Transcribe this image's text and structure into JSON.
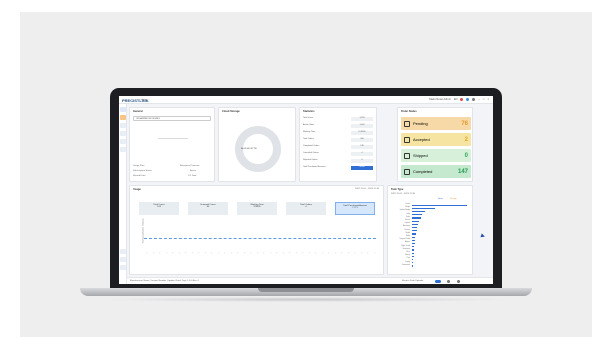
{
  "app": {
    "title": "PRECISTLINK",
    "subtitle": "Home"
  },
  "topbar": {
    "user": "Mario Rossi Admin",
    "language": "EN"
  },
  "sidebar": {
    "items": [
      "home",
      "orders",
      "work",
      "stats",
      "settings",
      "more"
    ]
  },
  "general": {
    "title": "General",
    "select_value": "ORGANIZATION DETAILS",
    "rows": [
      {
        "label": "Usage Plan",
        "value": "Enterprise Premium"
      },
      {
        "label": "Subscription Status",
        "value": "Active"
      },
      {
        "label": "Shared Data",
        "value": "1/2 Total"
      }
    ]
  },
  "storage": {
    "title": "Cloud Storage",
    "center_label": "46.05 GB / 87 TB"
  },
  "statistics": {
    "title": "Statistics",
    "rows": [
      {
        "label": "Total Users",
        "value": "1,234"
      },
      {
        "label": "Active Users",
        "value": "1,002"
      },
      {
        "label": "Working Time",
        "value": "12,892h"
      },
      {
        "label": "Total Orders",
        "value": "160"
      },
      {
        "label": "Completed Orders",
        "value": "135"
      },
      {
        "label": "Cancelled Orders",
        "value": "4"
      },
      {
        "label": "Rejected Orders",
        "value": "0"
      },
      {
        "label": "Total Purchased Services",
        "value": "Share"
      }
    ]
  },
  "order_status": {
    "title": "Order Status",
    "items": [
      {
        "label": "Pending",
        "value": "76",
        "color": "#f6d9a6",
        "num_color": "#e59a2c"
      },
      {
        "label": "Accepted",
        "value": "2",
        "color": "#f6e4a3",
        "num_color": "#e5a82c"
      },
      {
        "label": "Shipped",
        "value": "0",
        "color": "#d6f0d9",
        "num_color": "#35a35a"
      },
      {
        "label": "Completed",
        "value": "147",
        "color": "#c4e9cf",
        "num_color": "#1f9a52"
      }
    ]
  },
  "usage": {
    "title": "Usage",
    "date_range": "2022-11-01 - 2023-11-30",
    "tiles": [
      {
        "label": "Total Cases",
        "value": "163"
      },
      {
        "label": "Scanned Cases",
        "value": "90"
      },
      {
        "label": "Working Time",
        "value": "12892h"
      },
      {
        "label": "Total Orders",
        "value": "4"
      },
      {
        "label": "Total Purchased Amount",
        "value": "€ 771"
      }
    ],
    "y_label": "Total Cases (Number of Cases)"
  },
  "top_class": {
    "title": "Task Type",
    "date_range": "2022-11-01 - 2023-11-30",
    "legend": [
      "Scan",
      "Design"
    ],
    "labels": [
      "Crown",
      "Bridge",
      "Implant Bridge",
      "Inlay",
      "Onlay",
      "Veneer",
      "Implant",
      "Abutment",
      "Denture",
      "Model",
      "Splint",
      "Surgical Guide",
      "Aligner",
      "Night Guard",
      "Temporary",
      "Other",
      "Waxup",
      "Post",
      "Coping",
      "Framework"
    ],
    "values": [
      95,
      40,
      22,
      18,
      15,
      12,
      10,
      9,
      8,
      7,
      6,
      6,
      5,
      4,
      4,
      3,
      3,
      2,
      2,
      1
    ]
  },
  "footer": {
    "left": "Manufacturer Name, Version Number, Update-Check Tags 1.5.0-Rev 4",
    "right": "Restrict Data Uploads"
  }
}
